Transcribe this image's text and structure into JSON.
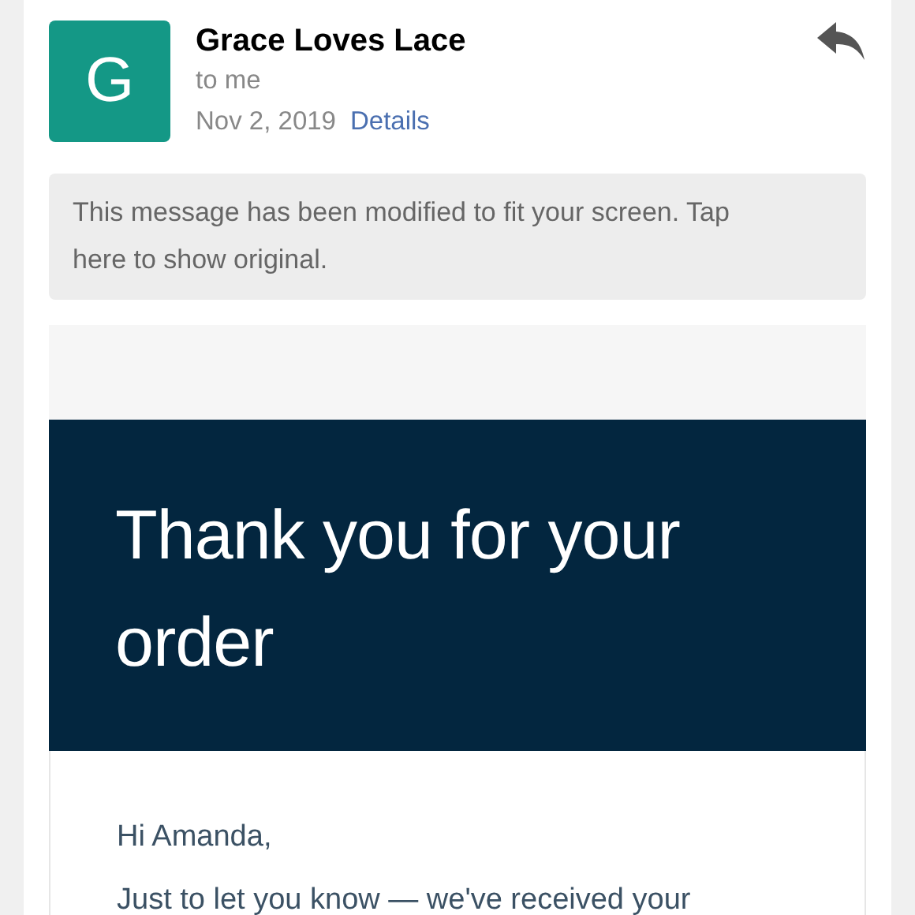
{
  "header": {
    "avatar_letter": "G",
    "sender": "Grace Loves Lace",
    "recipient": "to me",
    "date": "Nov 2, 2019",
    "details_link": "Details"
  },
  "notice": "This message has been modified to fit your screen. Tap here to show original.",
  "email": {
    "banner_title": "Thank you for your order",
    "greeting": "Hi Amanda,",
    "body_line": "Just to let you know — we've received your"
  }
}
